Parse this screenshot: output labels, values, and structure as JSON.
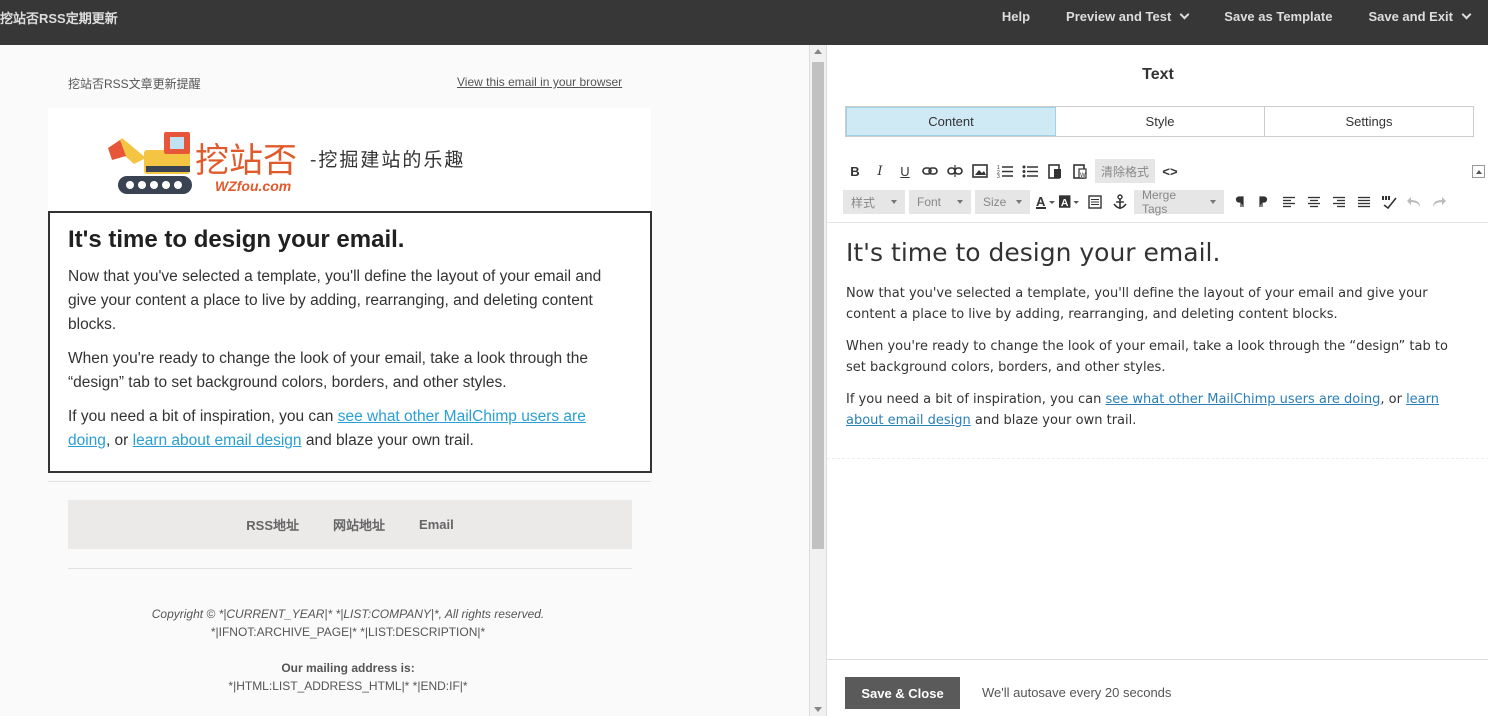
{
  "app": {
    "title": "挖站否RSS定期更新"
  },
  "nav": {
    "help": "Help",
    "preview": "Preview and Test",
    "save_template": "Save as Template",
    "save_exit": "Save and Exit"
  },
  "email": {
    "preheader": "挖站否RSS文章更新提醒",
    "view_link": "View this email in your browser",
    "logo": {
      "cn": "挖站否",
      "slogan": "-挖掘建站的乐趣",
      "en": "WZfou.com"
    },
    "heading": "It's time to design your email.",
    "p1": "Now that you've selected a template, you'll define the layout of your email and give your content a place to live by adding, rearranging, and deleting content blocks.",
    "p2": "When you're ready to change the look of your email, take a look through the “design” tab to set background colors, borders, and other styles.",
    "p3_pre": "If you need a bit of inspiration, you can ",
    "p3_link1": "see what other MailChimp users are doing",
    "p3_mid": ", or ",
    "p3_link2": "learn about email design",
    "p3_post": " and blaze your own trail.",
    "social": [
      "RSS地址",
      "网站地址",
      "Email"
    ],
    "footer": {
      "copyright": "Copyright © *|CURRENT_YEAR|* *|LIST:COMPANY|*, All rights reserved.",
      "archive": "*|IFNOT:ARCHIVE_PAGE|* *|LIST:DESCRIPTION|*",
      "address_label": "Our mailing address is:",
      "address": "*|HTML:LIST_ADDRESS_HTML|* *|END:IF|*"
    }
  },
  "panel": {
    "title": "Text",
    "tabs": [
      "Content",
      "Style",
      "Settings"
    ],
    "toolbar": {
      "bold": "B",
      "italic": "I",
      "underline": "U",
      "clear_format": "清除格式",
      "source": "<>",
      "styles": "样式",
      "font": "Font",
      "size": "Size",
      "merge_tags": "Merge Tags"
    },
    "editor": {
      "heading": "It's time to design your email.",
      "p1": "Now that you've selected a template, you'll define the layout of your email and give your content a place to live by adding, rearranging, and deleting content blocks.",
      "p2": "When you're ready to change the look of your email, take a look through the “design” tab to set background colors, borders, and other styles.",
      "p3_pre": "If you need a bit of inspiration, you can ",
      "p3_link1": "see what other MailChimp users are doing",
      "p3_mid": ", or ",
      "p3_link2": "learn about email design",
      "p3_post": " and blaze your own trail."
    },
    "save_close": "Save & Close",
    "autosave": "We'll autosave every 20 seconds"
  },
  "colors": {
    "topbar": "#373737",
    "accent_tab": "#cfe9f5",
    "link": "#2a9fd6",
    "logo_orange": "#e05a2b"
  }
}
